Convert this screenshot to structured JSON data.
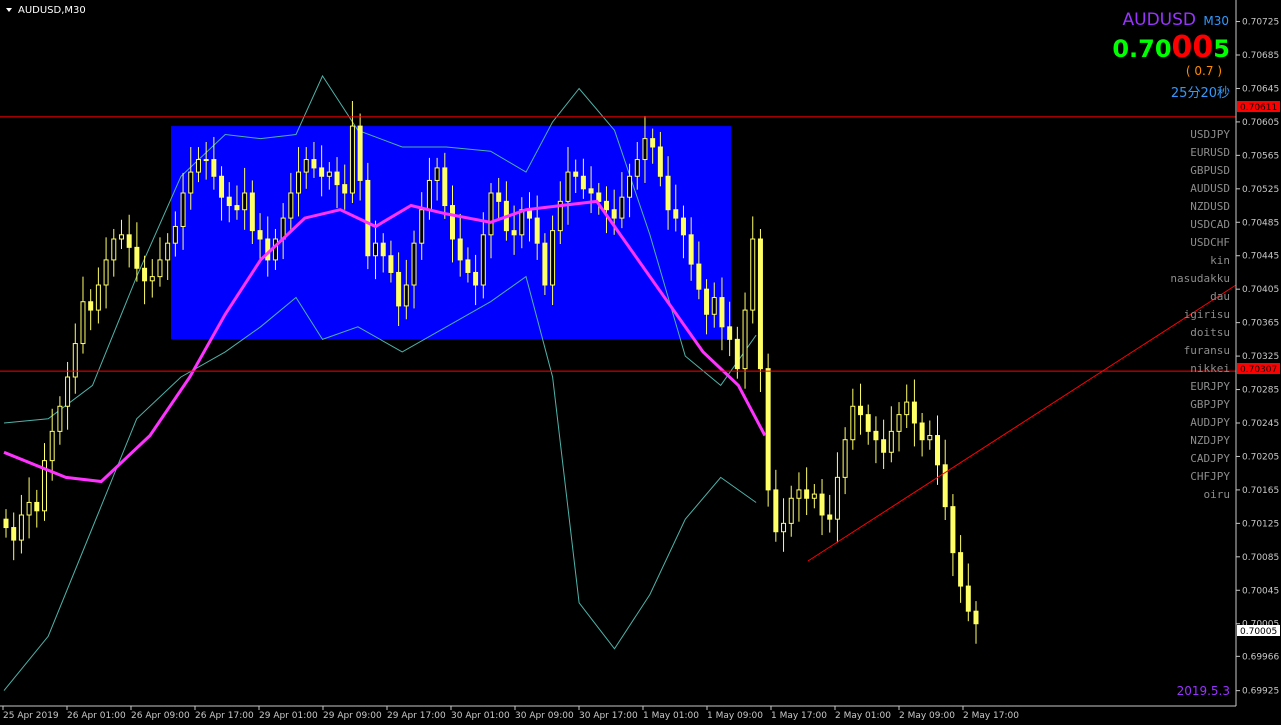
{
  "window": {
    "title": "AUDUSD,M30",
    "menu_icon": "triangle-down-icon"
  },
  "info_panel": {
    "symbol": "AUDUSD",
    "timeframe": "M30",
    "price_main": "0.70",
    "price_big": "00",
    "price_last": "5",
    "spread": "( 0.7 )",
    "timer": "25分20秒"
  },
  "symbol_list": [
    "USDJPY",
    "EURUSD",
    "GBPUSD",
    "AUDUSD",
    "NZDUSD",
    "USDCAD",
    "USDCHF",
    "kin",
    "nasudakku",
    "dau",
    "igirisu",
    "doitsu",
    "furansu",
    "nikkei",
    "EURJPY",
    "GBPJPY",
    "AUDJPY",
    "NZDJPY",
    "CADJPY",
    "CHFJPY",
    "oiru"
  ],
  "date_stamp": "2019.5.3",
  "level_labels": {
    "upper": "0.70611",
    "lower": "0.70307",
    "current": "0.70005"
  },
  "colors": {
    "background": "#000000",
    "candle": "#ffff66",
    "moving_average": "#ff33ff",
    "bollinger": "#4fb3a9",
    "zone": "#0000ff",
    "level_line": "#ff0000",
    "price_main": "#00ff00",
    "price_big": "#ff0000",
    "spread": "#ff8c00",
    "symbol_title": "#9933ff",
    "timer": "#3399ff",
    "date_stamp": "#9933ff"
  },
  "chart_data": {
    "type": "candlestick",
    "symbol": "AUDUSD",
    "timeframe": "M30",
    "y_ticks": [
      "0.70725",
      "0.70685",
      "0.70645",
      "0.70605",
      "0.70565",
      "0.70525",
      "0.70485",
      "0.70445",
      "0.70405",
      "0.70365",
      "0.70325",
      "0.70285",
      "0.70245",
      "0.70205",
      "0.70165",
      "0.70125",
      "0.70085",
      "0.70045",
      "0.70005",
      "0.69966",
      "0.69925"
    ],
    "ylim": [
      0.69915,
      0.7074
    ],
    "x_ticks": [
      "25 Apr 2019",
      "26 Apr 01:00",
      "26 Apr 09:00",
      "26 Apr 17:00",
      "29 Apr 01:00",
      "29 Apr 09:00",
      "29 Apr 17:00",
      "30 Apr 01:00",
      "30 Apr 09:00",
      "30 Apr 17:00",
      "1 May 01:00",
      "1 May 09:00",
      "1 May 17:00",
      "2 May 01:00",
      "2 May 09:00",
      "2 May 17:00"
    ],
    "horizontal_levels": [
      0.70611,
      0.70307
    ],
    "current_price": 0.70005,
    "rectangle_zone": {
      "x_from": 0,
      "x_to": 88,
      "price_top": 0.706,
      "price_bottom": 0.70345
    },
    "trendline": {
      "from_index": 125,
      "from_price": 0.7008,
      "to_index": 182,
      "to_price": 0.7041
    },
    "series": {
      "close_path": [
        0.7012,
        0.70105,
        0.70135,
        0.7015,
        0.7014,
        0.702,
        0.70235,
        0.70265,
        0.703,
        0.7034,
        0.7039,
        0.7038,
        0.7041,
        0.7044,
        0.70465,
        0.7047,
        0.70455,
        0.7043,
        0.70415,
        0.7042,
        0.7044,
        0.7046,
        0.7048,
        0.7052,
        0.70545,
        0.7056,
        0.7056,
        0.7054,
        0.70515,
        0.70505,
        0.705,
        0.7052,
        0.70475,
        0.70465,
        0.7044,
        0.70465,
        0.7049,
        0.7052,
        0.70545,
        0.7056,
        0.7055,
        0.7054,
        0.70545,
        0.7053,
        0.7052,
        0.706,
        0.70535,
        0.70445,
        0.7046,
        0.70445,
        0.70425,
        0.70385,
        0.7041,
        0.7046,
        0.705,
        0.70535,
        0.7055,
        0.70505,
        0.70465,
        0.7044,
        0.70425,
        0.7041,
        0.7047,
        0.7052,
        0.7051,
        0.70475,
        0.7047,
        0.705,
        0.7049,
        0.7046,
        0.7041,
        0.70475,
        0.7051,
        0.70545,
        0.7054,
        0.70525,
        0.7052,
        0.7051,
        0.705,
        0.7049,
        0.70515,
        0.7054,
        0.7056,
        0.70585,
        0.70575,
        0.7054,
        0.705,
        0.7049,
        0.7047,
        0.70435,
        0.70405,
        0.70375,
        0.70395,
        0.7036,
        0.70345,
        0.7031,
        0.7038,
        0.70465,
        0.7031,
        0.70165,
        0.70115,
        0.70125,
        0.70155,
        0.70165,
        0.70155,
        0.7016,
        0.70135,
        0.7013,
        0.7018,
        0.70225,
        0.70265,
        0.70255,
        0.70235,
        0.70225,
        0.7021,
        0.70235,
        0.70255,
        0.7027,
        0.70245,
        0.70225,
        0.7023,
        0.70195,
        0.70145,
        0.7009,
        0.7005,
        0.7002,
        0.70005
      ],
      "moving_average": [
        [
          0.7021,
          0
        ],
        [
          0.7018,
          14
        ],
        [
          0.70175,
          22
        ],
        [
          0.7023,
          33
        ],
        [
          0.703,
          42
        ],
        [
          0.70375,
          50
        ],
        [
          0.7044,
          58
        ],
        [
          0.7049,
          68
        ],
        [
          0.705,
          76
        ],
        [
          0.7048,
          84
        ],
        [
          0.70505,
          92
        ],
        [
          0.70495,
          100
        ],
        [
          0.70485,
          110
        ],
        [
          0.705,
          118
        ],
        [
          0.70505,
          126
        ],
        [
          0.7051,
          134
        ],
        [
          0.7045,
          142
        ],
        [
          0.7039,
          150
        ],
        [
          0.7033,
          158
        ],
        [
          0.7029,
          166
        ],
        [
          0.7023,
          172
        ]
      ],
      "bollinger_upper": [
        [
          0.70245,
          0
        ],
        [
          0.7025,
          10
        ],
        [
          0.7029,
          20
        ],
        [
          0.7042,
          30
        ],
        [
          0.7054,
          40
        ],
        [
          0.7059,
          50
        ],
        [
          0.70585,
          58
        ],
        [
          0.7059,
          66
        ],
        [
          0.7066,
          72
        ],
        [
          0.70595,
          80
        ],
        [
          0.70575,
          90
        ],
        [
          0.70575,
          100
        ],
        [
          0.7057,
          110
        ],
        [
          0.70545,
          118
        ],
        [
          0.70605,
          124
        ],
        [
          0.70645,
          130
        ],
        [
          0.70595,
          138
        ],
        [
          0.7047,
          146
        ],
        [
          0.70325,
          154
        ],
        [
          0.7029,
          162
        ],
        [
          0.7035,
          170
        ]
      ],
      "bollinger_lower": [
        [
          0.69925,
          0
        ],
        [
          0.6999,
          10
        ],
        [
          0.7012,
          20
        ],
        [
          0.7025,
          30
        ],
        [
          0.703,
          40
        ],
        [
          0.7033,
          50
        ],
        [
          0.7036,
          58
        ],
        [
          0.70395,
          66
        ],
        [
          0.70345,
          72
        ],
        [
          0.7036,
          80
        ],
        [
          0.7033,
          90
        ],
        [
          0.7036,
          100
        ],
        [
          0.7039,
          110
        ],
        [
          0.7042,
          118
        ],
        [
          0.703,
          124
        ],
        [
          0.7003,
          130
        ],
        [
          0.69975,
          138
        ],
        [
          0.7004,
          146
        ],
        [
          0.7013,
          154
        ],
        [
          0.7018,
          162
        ],
        [
          0.7015,
          170
        ]
      ]
    }
  }
}
